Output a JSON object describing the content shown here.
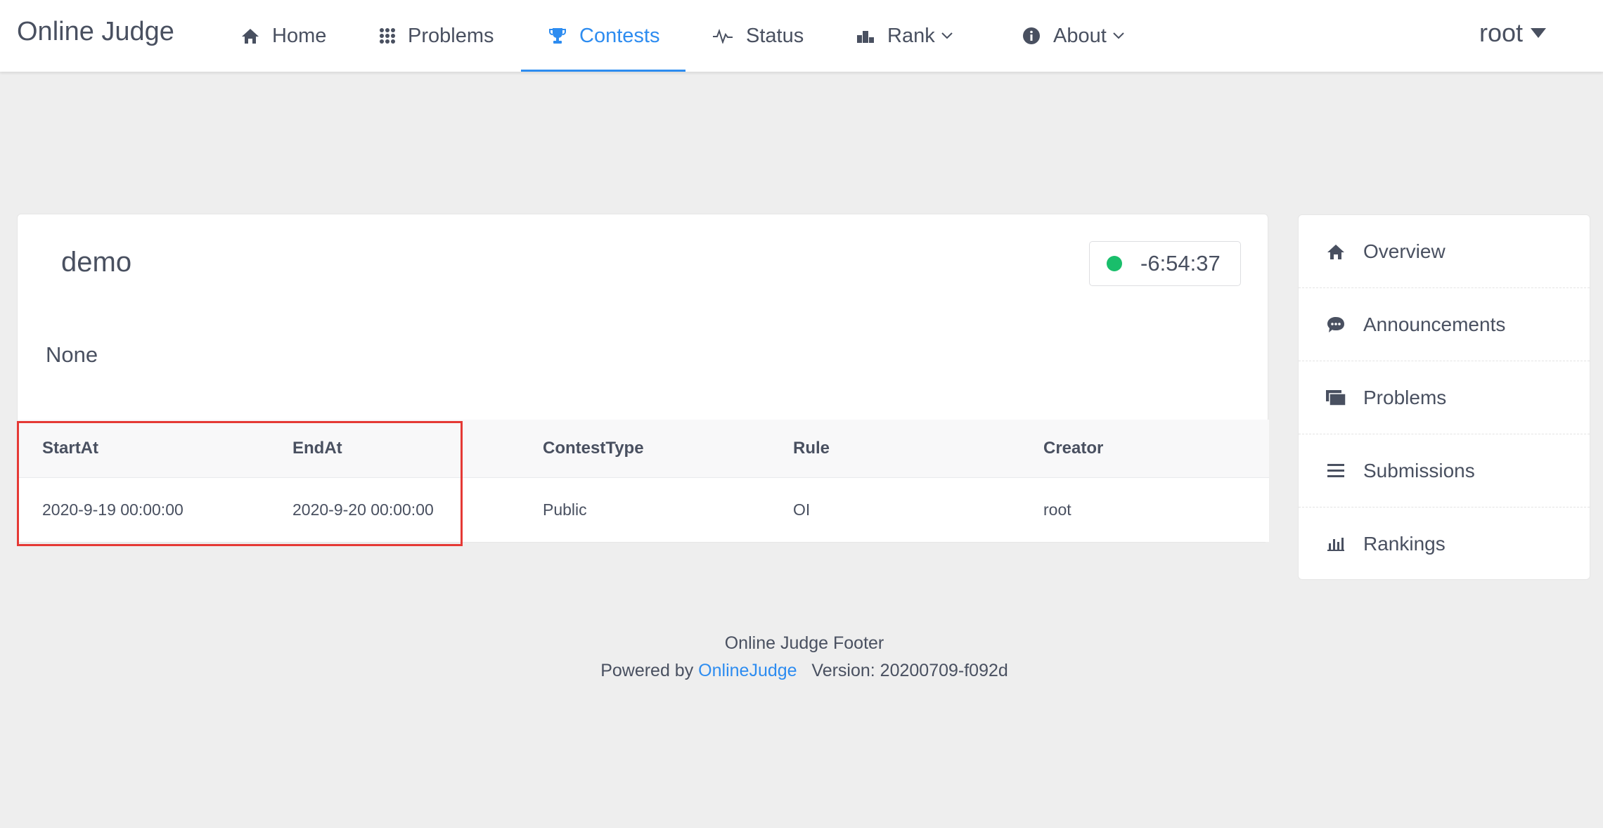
{
  "header": {
    "brand": "Online Judge",
    "nav": [
      {
        "label": "Home",
        "icon": "home-icon"
      },
      {
        "label": "Problems",
        "icon": "grid-icon"
      },
      {
        "label": "Contests",
        "icon": "trophy-icon",
        "active": true
      },
      {
        "label": "Status",
        "icon": "pulse-icon"
      },
      {
        "label": "Rank",
        "icon": "podium-icon",
        "dropdown": true
      },
      {
        "label": "About",
        "icon": "info-icon",
        "dropdown": true
      }
    ],
    "user": "root"
  },
  "contest": {
    "title": "demo",
    "countdown": "-6:54:37",
    "status_color": "#19be6b",
    "description": "None",
    "table": {
      "headers": [
        "StartAt",
        "EndAt",
        "ContestType",
        "Rule",
        "Creator"
      ],
      "row": [
        "2020-9-19 00:00:00",
        "2020-9-20 00:00:00",
        "Public",
        "OI",
        "root"
      ]
    }
  },
  "sidebar": {
    "items": [
      {
        "label": "Overview",
        "icon": "home-icon"
      },
      {
        "label": "Announcements",
        "icon": "chat-bubble-icon"
      },
      {
        "label": "Problems",
        "icon": "stacked-pages-icon"
      },
      {
        "label": "Submissions",
        "icon": "list-icon"
      },
      {
        "label": "Rankings",
        "icon": "bar-chart-icon"
      }
    ]
  },
  "footer": {
    "line1": "Online Judge Footer",
    "powered_by": "Powered by",
    "link": "OnlineJudge",
    "version": "Version: 20200709-f092d"
  },
  "colors": {
    "accent": "#2d8cf0",
    "text": "#495060",
    "highlight": "#e53935",
    "background": "#eeeeee"
  }
}
